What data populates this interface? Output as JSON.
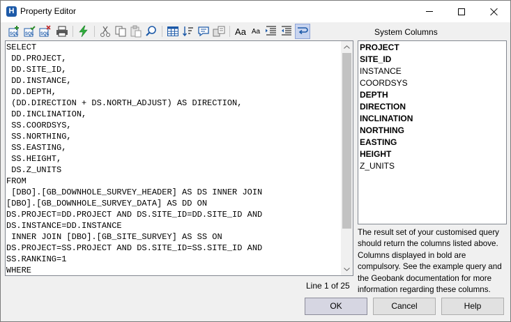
{
  "window": {
    "title": "Property Editor",
    "app_icon_letter": "H"
  },
  "toolbar": {
    "icons": [
      "add-sql-icon",
      "check-sql-icon",
      "remove-sql-icon",
      "print-icon",
      "execute-icon",
      "cut-icon",
      "copy-icon",
      "paste-icon",
      "find-icon",
      "grid-icon",
      "sort-icon",
      "comment-icon",
      "layout-icon",
      "font-larger-icon",
      "font-smaller-icon",
      "indent-icon",
      "outdent-icon",
      "word-wrap-icon"
    ],
    "font_larger_label": "Aa",
    "font_smaller_label": "Aa"
  },
  "system_columns": {
    "title": "System Columns",
    "items": [
      {
        "name": "PROJECT",
        "bold": true
      },
      {
        "name": "SITE_ID",
        "bold": true
      },
      {
        "name": "INSTANCE",
        "bold": false
      },
      {
        "name": "COORDSYS",
        "bold": false
      },
      {
        "name": "DEPTH",
        "bold": true
      },
      {
        "name": "DIRECTION",
        "bold": true
      },
      {
        "name": "INCLINATION",
        "bold": true
      },
      {
        "name": "NORTHING",
        "bold": true
      },
      {
        "name": "EASTING",
        "bold": true
      },
      {
        "name": "HEIGHT",
        "bold": true
      },
      {
        "name": "Z_UNITS",
        "bold": false
      }
    ],
    "help_text": "The result set of your customised query should return the columns listed above. Columns displayed in bold are compulsory. See the example query and the Geobank documentation for more information regarding these columns."
  },
  "editor": {
    "lines": [
      "SELECT",
      " DD.PROJECT,",
      " DD.SITE_ID,",
      " DD.INSTANCE,",
      " DD.DEPTH,",
      " (DD.DIRECTION + DS.NORTH_ADJUST) AS DIRECTION,",
      " DD.INCLINATION,",
      " SS.COORDSYS,",
      " SS.NORTHING,",
      " SS.EASTING,",
      " SS.HEIGHT,",
      " DS.Z_UNITS",
      "FROM",
      " [DBO].[GB_DOWNHOLE_SURVEY_HEADER] AS DS INNER JOIN",
      "[DBO].[GB_DOWNHOLE_SURVEY_DATA] AS DD ON",
      "DS.PROJECT=DD.PROJECT AND DS.SITE_ID=DD.SITE_ID AND",
      "DS.INSTANCE=DD.INSTANCE",
      " INNER JOIN [DBO].[GB_SITE_SURVEY] AS SS ON",
      "DS.PROJECT=SS.PROJECT AND DS.SITE_ID=SS.SITE_ID AND",
      "SS.RANKING=1",
      "WHERE"
    ],
    "line_info": "Line 1 of 25"
  },
  "buttons": {
    "ok": "OK",
    "cancel": "Cancel",
    "help": "Help"
  }
}
